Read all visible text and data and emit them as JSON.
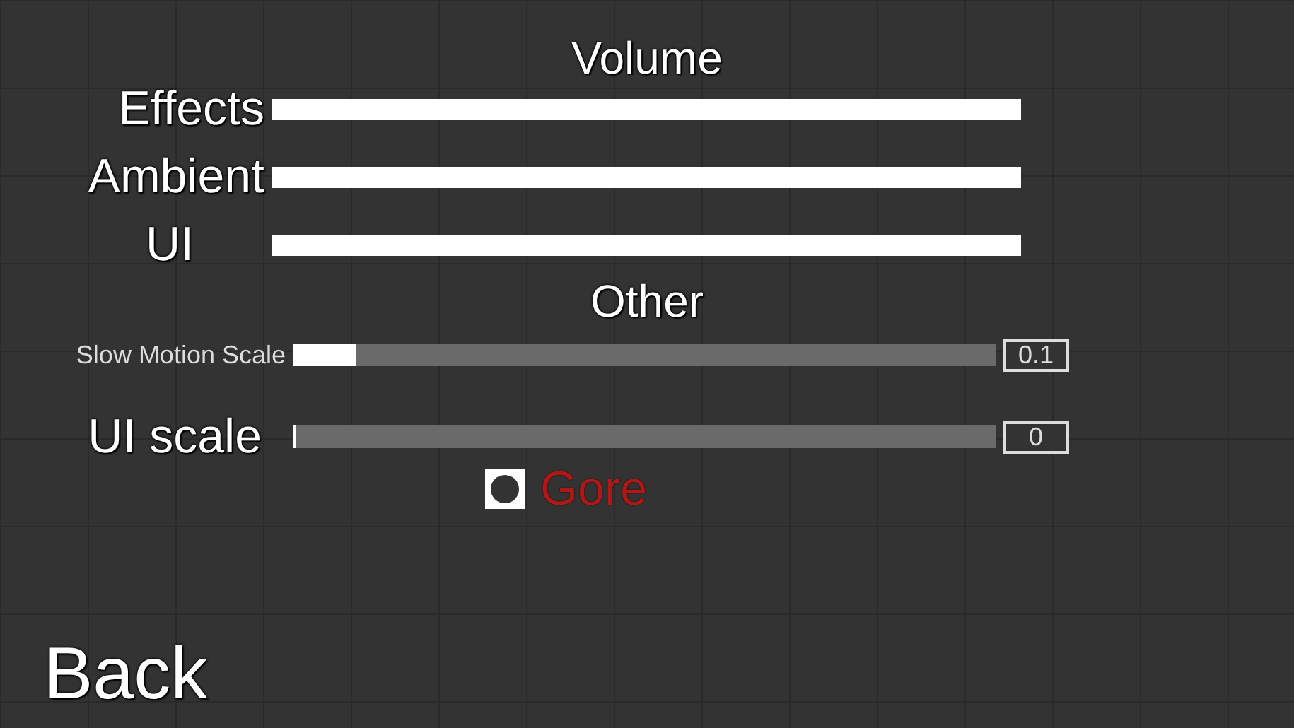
{
  "volume": {
    "title": "Volume",
    "channels": [
      {
        "label": "Effects",
        "level": 1
      },
      {
        "label": "Ambient",
        "level": 1
      },
      {
        "label": "UI",
        "level": 1
      }
    ]
  },
  "other": {
    "title": "Other",
    "settings": [
      {
        "kind": "compact-slider",
        "label": "Slow Motion Scale",
        "level": 0.09,
        "value": "0.1"
      },
      {
        "kind": "slider",
        "label": "UI scale",
        "level": 0,
        "value": "0"
      },
      {
        "kind": "toggle",
        "label": "Gore",
        "checked": true
      }
    ]
  },
  "back": "Back"
}
